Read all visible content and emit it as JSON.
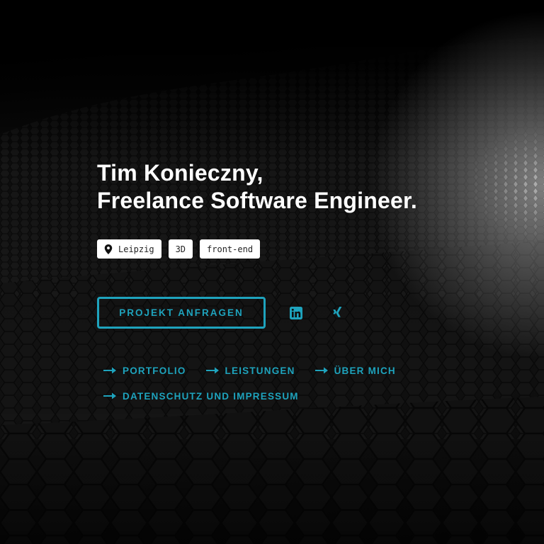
{
  "hero": {
    "line1": "Tim Konieczny,",
    "line2": "Freelance Software Engineer."
  },
  "tags": [
    {
      "label": "Leipzig",
      "icon": "map-pin-icon"
    },
    {
      "label": "3D"
    },
    {
      "label": "front-end"
    }
  ],
  "cta": {
    "label": "PROJEKT ANFRAGEN"
  },
  "social": [
    {
      "name": "linkedin-icon"
    },
    {
      "name": "xing-icon"
    }
  ],
  "nav": {
    "portfolio": "PORTFOLIO",
    "leistungen": "LEISTUNGEN",
    "ueber_mich": "ÜBER MICH",
    "datenschutz": "DATENSCHUTZ UND IMPRESSUM"
  },
  "colors": {
    "accent": "#1ea3bd",
    "background": "#000000",
    "text": "#ffffff"
  }
}
